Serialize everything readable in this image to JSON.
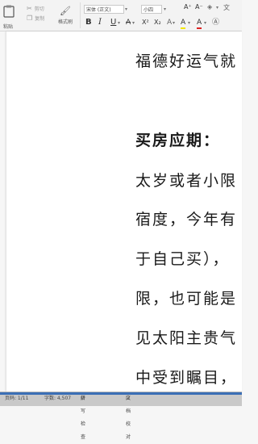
{
  "ribbon": {
    "paste_label": "粘贴",
    "cut_label": "剪切",
    "copy_label": "复制",
    "format_painter_label": "格式刷",
    "font_name": "宋体 (正文)",
    "font_size": "小四",
    "bold_glyph": "B",
    "italic_glyph": "I",
    "underline_glyph": "U",
    "strike_glyph": "A",
    "superscript_glyph": "X²",
    "subscript_glyph": "X₂",
    "font_grow_glyph": "A⁺",
    "font_shrink_glyph": "A⁻",
    "font_color_glyph": "A",
    "highlight_glyph": "A"
  },
  "document": {
    "lines": [
      "福德好运气就",
      "买房应期：",
      "太岁或者小限",
      "宿度，今年有",
      "于自己买），",
      "限，也可能是",
      "见太阳主贵气",
      "中受到瞩目，"
    ]
  },
  "statusbar": {
    "page": "页码: 1/11",
    "words": "字数: 4,507",
    "spell": "拼写检查",
    "doc_check": "文档校对"
  },
  "colors": {
    "ribbon_bg": "#f3f3f3",
    "page_bg": "#ffffff",
    "status_bg": "#c9c9c9",
    "accent_blue": "#3b6fb6"
  }
}
